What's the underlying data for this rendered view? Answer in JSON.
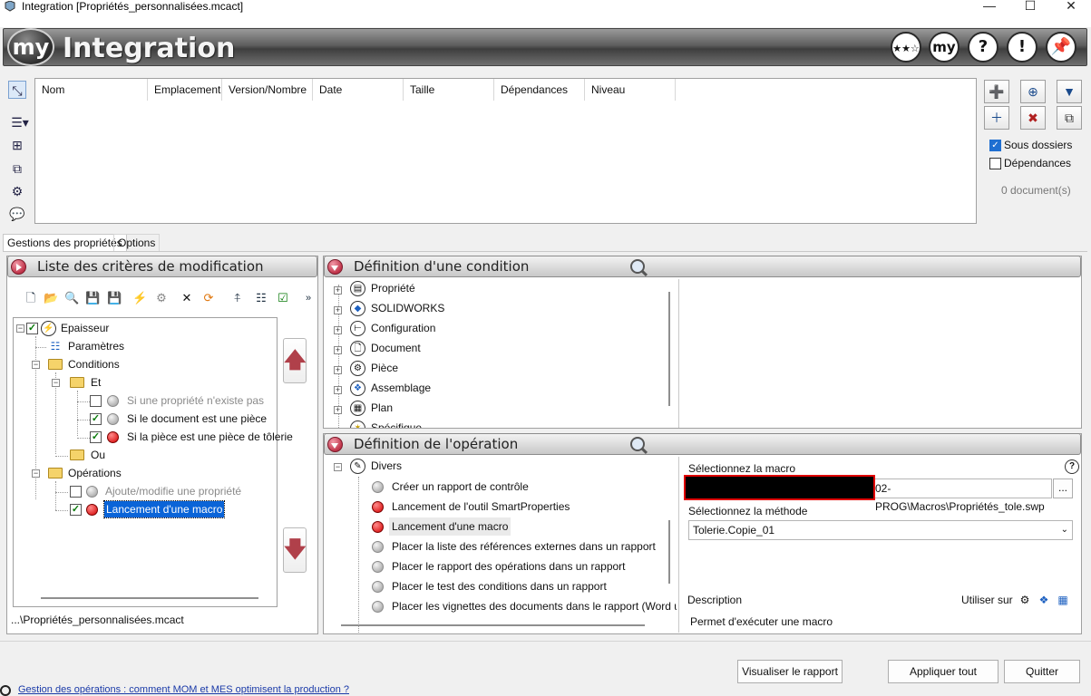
{
  "window": {
    "title": "Integration [Propriétés_personnalisées.mcact]",
    "controls": [
      "—",
      "☐",
      "✕"
    ]
  },
  "banner": {
    "logo_text": "my",
    "app_title": "Integration",
    "buttons": [
      "my",
      "?",
      "!"
    ]
  },
  "documents": {
    "columns": [
      "Nom",
      "Emplacement",
      "Version/Nombre",
      "Date",
      "Taille",
      "Dépendances",
      "Niveau"
    ],
    "subfolders_label": "Sous dossiers",
    "subfolders_checked": true,
    "dependencies_label": "Dépendances",
    "dependencies_checked": false,
    "count_label": "0 document(s)"
  },
  "tabs": [
    "Gestions des propriétés",
    "Options"
  ],
  "criteria_panel": {
    "title": "Liste des critères de modification",
    "tree": {
      "root": "Epaisseur",
      "parametres": "Paramètres",
      "conditions": "Conditions",
      "et": "Et",
      "cond1": "Si une propriété n'existe pas",
      "cond2": "Si le document est une pièce",
      "cond3": "Si la pièce est une pièce de tôlerie",
      "ou": "Ou",
      "operations": "Opérations",
      "op1": "Ajoute/modifie une propriété",
      "op2": "Lancement d'une macro"
    },
    "file_path": "...\\Propriétés_personnalisées.mcact"
  },
  "condition_panel": {
    "title": "Définition d'une condition",
    "items": [
      "Propriété",
      "SOLIDWORKS",
      "Configuration",
      "Document",
      "Pièce",
      "Assemblage",
      "Plan",
      "Spécifique"
    ]
  },
  "operation_panel": {
    "title": "Définition de l'opération",
    "category": "Divers",
    "items": [
      "Créer un rapport de contrôle",
      "Lancement de l'outil SmartProperties",
      "Lancement d'une macro",
      "Placer la liste des références externes dans un rapport",
      "Placer le rapport des opérations dans un rapport",
      "Placer le test des conditions dans un rapport",
      "Placer les vignettes des documents dans le rapport (Word uniq"
    ],
    "macro_label": "Sélectionnez la macro",
    "macro_path": "02-PROG\\Macros\\Propriétés_tole.swp",
    "browse_label": "...",
    "method_label": "Sélectionnez la méthode",
    "method_value": "Tolerie.Copie_01",
    "description_label": "Description",
    "use_on_label": "Utiliser sur",
    "description_text": "Permet d'exécuter une macro"
  },
  "footer": {
    "link_text": "Gestion des opérations : comment MOM et MES optimisent la production ?",
    "view_report": "Visualiser le rapport",
    "apply_all": "Appliquer tout",
    "quit": "Quitter"
  },
  "colors": {
    "accent": "#0a64d8",
    "red_status": "#d40000",
    "check_green": "#0a7a0a"
  }
}
